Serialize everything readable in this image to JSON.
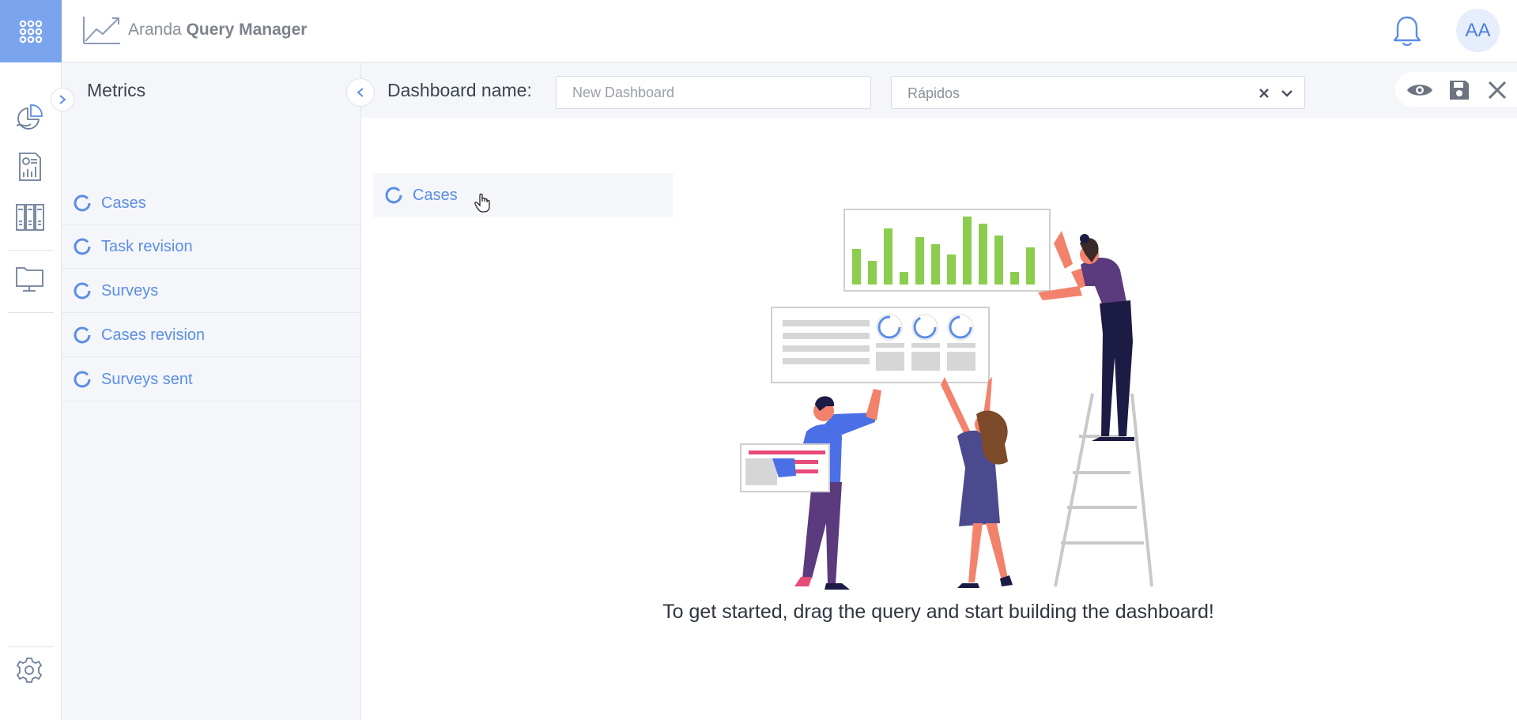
{
  "app": {
    "brand_prefix": "Aranda ",
    "brand_main": "Query Manager",
    "avatar_initials": "AA"
  },
  "colors": {
    "accent": "#7aa4ee",
    "link_blue": "#5b8ee6",
    "panel_bg": "#f4f6fa",
    "bar_green": "#8ccd4f"
  },
  "icons": {
    "apps": "apps-grid-icon",
    "notifications": "bell-icon",
    "rail": [
      "pie-chart-icon",
      "report-icon",
      "bookshelf-icon",
      "monitor-folder-icon",
      "settings-gear-icon"
    ]
  },
  "metrics": {
    "title": "Metrics",
    "items": [
      {
        "label": "Cases"
      },
      {
        "label": "Task revision"
      },
      {
        "label": "Surveys"
      },
      {
        "label": "Cases revision"
      },
      {
        "label": "Surveys sent"
      }
    ]
  },
  "toolbar": {
    "dashboard_label": "Dashboard name:",
    "name_placeholder": "New Dashboard",
    "name_value": "",
    "category_value": "Rápidos",
    "actions": [
      "preview-eye-icon",
      "save-disk-icon",
      "close-icon"
    ]
  },
  "canvas": {
    "dragged_item": "Cases",
    "hint": "To get started, drag the query and start building the dashboard!"
  }
}
